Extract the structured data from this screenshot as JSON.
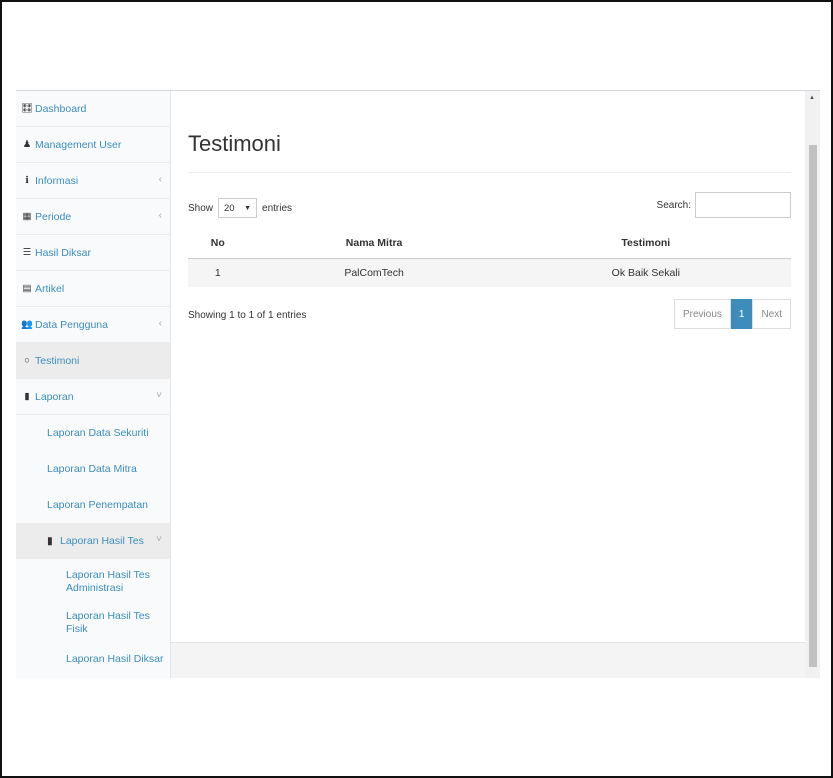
{
  "sidebar": {
    "items": [
      {
        "label": "Dashboard",
        "icon": "dashboard-icon",
        "glyph": "🎛",
        "arrow": ""
      },
      {
        "label": "Management User",
        "icon": "user-icon",
        "glyph": "♟",
        "arrow": ""
      },
      {
        "label": "Informasi",
        "icon": "info-icon",
        "glyph": "ℹ",
        "arrow": "‹"
      },
      {
        "label": "Periode",
        "icon": "calendar-icon",
        "glyph": "▦",
        "arrow": "‹"
      },
      {
        "label": "Hasil Diksar",
        "icon": "table-icon",
        "glyph": "☰",
        "arrow": ""
      },
      {
        "label": "Artikel",
        "icon": "newspaper-icon",
        "glyph": "▤",
        "arrow": ""
      },
      {
        "label": "Data Pengguna",
        "icon": "users-icon",
        "glyph": "👥",
        "arrow": "‹"
      },
      {
        "label": "Testimoni",
        "icon": "comment-icon",
        "glyph": "○",
        "arrow": ""
      },
      {
        "label": "Laporan",
        "icon": "file-icon",
        "glyph": "▮",
        "arrow": "˅"
      }
    ],
    "laporan_sub": [
      {
        "label": "Laporan Data Sekuriti"
      },
      {
        "label": "Laporan Data Mitra"
      },
      {
        "label": "Laporan Penempatan"
      }
    ],
    "hasil_tes": {
      "label": "Laporan Hasil Tes",
      "icon": "file-icon",
      "glyph": "▮",
      "arrow": "˅"
    },
    "hasil_tes_sub": [
      {
        "label": "Laporan Hasil Tes Administrasi"
      },
      {
        "label": "Laporan Hasil Tes Fisik"
      },
      {
        "label": "Laporan Hasil Diksar"
      }
    ]
  },
  "main": {
    "title": "Testimoni",
    "show_label": "Show",
    "page_length": "20",
    "entries_label": "entries",
    "search_label": "Search:",
    "search_value": "",
    "table": {
      "headers": [
        "No",
        "Nama Mitra",
        "Testimoni"
      ],
      "rows": [
        [
          "1",
          "PalComTech",
          "Ok Baik Sekali"
        ]
      ]
    },
    "info": "Showing 1 to 1 of 1 entries",
    "pagination": {
      "previous": "Previous",
      "current": "1",
      "next": "Next"
    }
  },
  "colors": {
    "accent": "#3c8dbc",
    "sidebar_bg": "#f9fafc",
    "row_bg": "#f5f5f5"
  }
}
